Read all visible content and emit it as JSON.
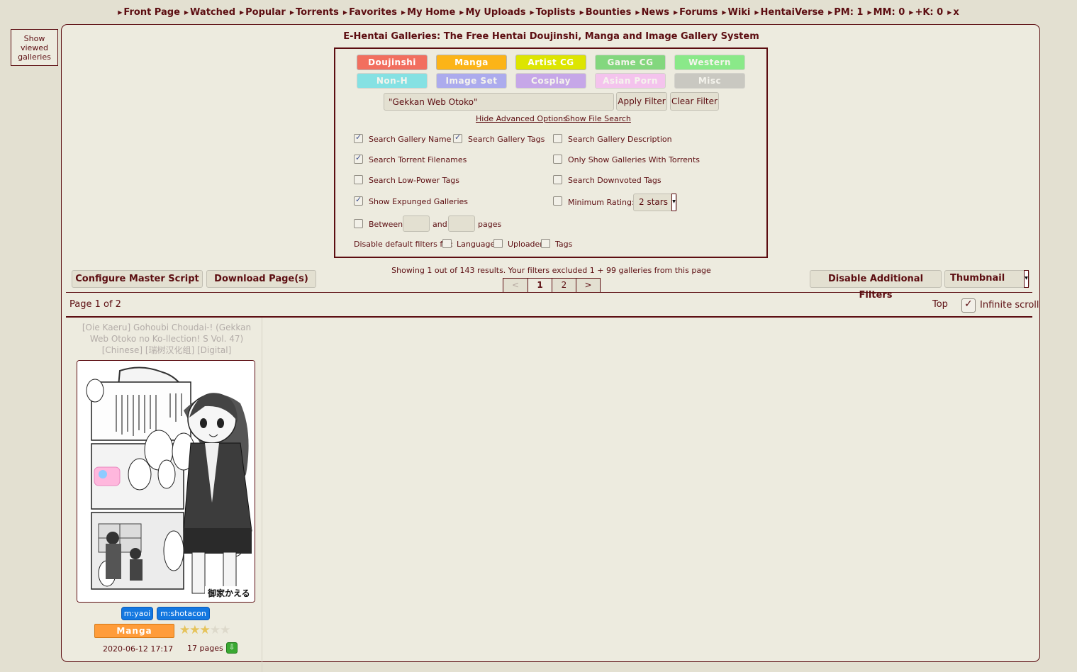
{
  "nav": {
    "items": [
      "Front Page",
      "Watched",
      "Popular",
      "Torrents",
      "Favorites",
      "My Home",
      "My Uploads",
      "Toplists",
      "Bounties",
      "News",
      "Forums",
      "Wiki",
      "HentaiVerse",
      "PM: 1",
      "MM: 0",
      "+K: 0",
      "x"
    ]
  },
  "show_viewed": "Show viewed galleries",
  "site_title": "E-Hentai Galleries: The Free Hentai Doujinshi, Manga and Image Gallery System",
  "categories": [
    {
      "label": "Doujinshi",
      "color": "#f26f5f",
      "active": true
    },
    {
      "label": "Manga",
      "color": "#fcb417",
      "active": true
    },
    {
      "label": "Artist CG",
      "color": "#dde500",
      "active": true
    },
    {
      "label": "Game CG",
      "color": "#05bf0b",
      "active": false
    },
    {
      "label": "Western",
      "color": "#14e723",
      "active": false
    },
    {
      "label": "Non-H",
      "color": "#08d7e9",
      "active": false
    },
    {
      "label": "Image Set",
      "color": "#5f5fff",
      "active": false
    },
    {
      "label": "Cosplay",
      "color": "#9755f5",
      "active": false
    },
    {
      "label": "Asian Porn",
      "color": "#fe93ff",
      "active": false
    },
    {
      "label": "Misc",
      "color": "#9e9e9e",
      "active": false
    }
  ],
  "search": {
    "value": "\"Gekkan Web Otoko\"",
    "apply_label": "Apply Filter",
    "clear_label": "Clear Filter",
    "hide_advanced": "Hide Advanced Options",
    "show_file_search": "Show File Search"
  },
  "advanced": {
    "search_gallery_name": "Search Gallery Name",
    "search_gallery_tags": "Search Gallery Tags",
    "search_gallery_description": "Search Gallery Description",
    "search_torrent_filenames": "Search Torrent Filenames",
    "only_show_torrents": "Only Show Galleries With Torrents",
    "search_low_power": "Search Low-Power Tags",
    "search_downvoted": "Search Downvoted Tags",
    "show_expunged": "Show Expunged Galleries",
    "minimum_rating": "Minimum Rating:",
    "rating_value": "2 stars",
    "between": "Between",
    "and": "and",
    "pages": "pages",
    "disable_default": "Disable default filters for:",
    "language": "Language",
    "uploader": "Uploader",
    "tags": "Tags"
  },
  "toolbar": {
    "configure": "Configure Master Script",
    "download": "Download Page(s)",
    "disable_filters": "Disable Additional Filters",
    "view_mode": "Thumbnail"
  },
  "results": {
    "showing": "Showing 1 out of 143 results. Your filters excluded 1 + 99 galleries from this page",
    "pages": [
      "<",
      "1",
      "2",
      ">"
    ],
    "page_info": "Page 1 of 2",
    "top": "Top",
    "infinite_scroll": "Infinite scroll"
  },
  "gallery": {
    "title": "[Oie Kaeru] Gohoubi Choudai-! (Gekkan Web Otoko no Ko-llection! S Vol. 47) [Chinese] [瑞树汉化组] [Digital]",
    "tags": [
      "m:yaoi",
      "m:shotacon"
    ],
    "category": "Manga",
    "rating": 3,
    "date": "2020-06-12 17:17",
    "pages": "17 pages"
  }
}
